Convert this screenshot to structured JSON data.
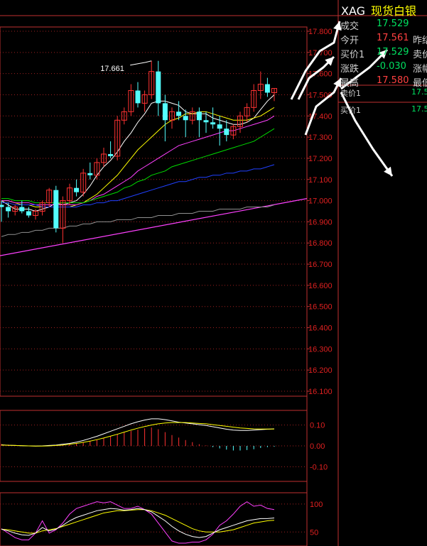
{
  "quote": {
    "code": "XAG",
    "name": "现货白银",
    "rows": [
      {
        "label": "成交",
        "value": "17.529",
        "dir": "dn",
        "label2": ""
      },
      {
        "label": "今开",
        "value": "17.561",
        "dir": "up",
        "label2": "昨结"
      },
      {
        "label": "买价1",
        "value": "17.529",
        "dir": "dn",
        "label2": "卖价"
      },
      {
        "label": "涨跌",
        "value": "-0.030",
        "dir": "dn",
        "label2": "涨幅"
      },
      {
        "label": "最高",
        "value": "17.580",
        "dir": "up",
        "label2": "最低"
      }
    ],
    "sell1_label": "卖价1",
    "sell1_value": "17.5",
    "buy1_label": "买价1",
    "buy1_value": "17.5"
  },
  "chart_data": [
    {
      "type": "candlestick",
      "ylim": [
        16.1,
        17.8
      ],
      "yticks": [
        "17.800",
        "17.700",
        "17.600",
        "17.500",
        "17.400",
        "17.300",
        "17.200",
        "17.100",
        "17.000",
        "16.900",
        "16.800",
        "16.700",
        "16.600",
        "16.500",
        "16.400",
        "16.300",
        "16.200",
        "16.100"
      ],
      "annotation": "17.661",
      "candles": [
        [
          16.98,
          17.0,
          16.9,
          16.97
        ],
        [
          16.97,
          16.99,
          16.92,
          16.95
        ],
        [
          16.95,
          16.98,
          16.93,
          16.97
        ],
        [
          16.97,
          17.0,
          16.94,
          16.95
        ],
        [
          16.95,
          16.97,
          16.92,
          16.93
        ],
        [
          16.93,
          16.96,
          16.91,
          16.95
        ],
        [
          16.95,
          17.0,
          16.93,
          16.99
        ],
        [
          16.99,
          17.06,
          16.97,
          17.05
        ],
        [
          17.05,
          17.07,
          16.85,
          16.87
        ],
        [
          16.87,
          17.02,
          16.8,
          17.0
        ],
        [
          17.0,
          17.08,
          16.98,
          17.06
        ],
        [
          17.06,
          17.1,
          17.02,
          17.04
        ],
        [
          17.04,
          17.15,
          17.02,
          17.13
        ],
        [
          17.13,
          17.18,
          17.1,
          17.12
        ],
        [
          17.12,
          17.2,
          17.1,
          17.18
        ],
        [
          17.18,
          17.25,
          17.16,
          17.22
        ],
        [
          17.22,
          17.28,
          17.2,
          17.21
        ],
        [
          17.21,
          17.4,
          17.19,
          17.38
        ],
        [
          17.38,
          17.44,
          17.36,
          17.42
        ],
        [
          17.42,
          17.55,
          17.4,
          17.52
        ],
        [
          17.52,
          17.56,
          17.44,
          17.46
        ],
        [
          17.46,
          17.52,
          17.42,
          17.5
        ],
        [
          17.5,
          17.66,
          17.48,
          17.61
        ],
        [
          17.61,
          17.66,
          17.4,
          17.46
        ],
        [
          17.46,
          17.5,
          17.28,
          17.38
        ],
        [
          17.38,
          17.44,
          17.34,
          17.42
        ],
        [
          17.42,
          17.47,
          17.38,
          17.4
        ],
        [
          17.4,
          17.43,
          17.3,
          17.38
        ],
        [
          17.38,
          17.44,
          17.36,
          17.42
        ],
        [
          17.42,
          17.44,
          17.3,
          17.38
        ],
        [
          17.38,
          17.42,
          17.32,
          17.37
        ],
        [
          17.37,
          17.44,
          17.34,
          17.36
        ],
        [
          17.36,
          17.4,
          17.26,
          17.34
        ],
        [
          17.34,
          17.38,
          17.28,
          17.31
        ],
        [
          17.31,
          17.36,
          17.29,
          17.35
        ],
        [
          17.35,
          17.42,
          17.32,
          17.4
        ],
        [
          17.4,
          17.46,
          17.37,
          17.44
        ],
        [
          17.44,
          17.55,
          17.42,
          17.52
        ],
        [
          17.52,
          17.61,
          17.48,
          17.55
        ],
        [
          17.55,
          17.58,
          17.49,
          17.51
        ],
        [
          17.51,
          17.53,
          17.47,
          17.53
        ]
      ],
      "moving_averages": [
        {
          "color": "#ffffff",
          "values": [
            17.0,
            16.98,
            16.96,
            16.96,
            16.96,
            16.95,
            16.96,
            16.97,
            16.99,
            16.98,
            16.99,
            17.0,
            17.03,
            17.07,
            17.12,
            17.16,
            17.19,
            17.23,
            17.28,
            17.32,
            17.37,
            17.41,
            17.46,
            17.47,
            17.47,
            17.46,
            17.45,
            17.42,
            17.41,
            17.41,
            17.41,
            17.39,
            17.38,
            17.37,
            17.36,
            17.36,
            17.37,
            17.39,
            17.43,
            17.47,
            17.5
          ]
        },
        {
          "color": "#ffff00",
          "values": [
            17.0,
            17.0,
            16.99,
            16.98,
            16.98,
            16.97,
            16.97,
            16.97,
            16.97,
            16.97,
            16.97,
            16.98,
            16.99,
            17.01,
            17.03,
            17.06,
            17.09,
            17.12,
            17.16,
            17.2,
            17.24,
            17.27,
            17.3,
            17.33,
            17.36,
            17.38,
            17.39,
            17.41,
            17.41,
            17.42,
            17.42,
            17.41,
            17.4,
            17.39,
            17.38,
            17.38,
            17.38,
            17.39,
            17.4,
            17.42,
            17.44
          ]
        },
        {
          "color": "#ff40ff",
          "values": [
            17.0,
            17.0,
            16.99,
            16.99,
            16.99,
            16.98,
            16.98,
            16.98,
            16.98,
            16.98,
            16.98,
            16.98,
            16.99,
            17.0,
            17.02,
            17.03,
            17.05,
            17.07,
            17.09,
            17.11,
            17.14,
            17.16,
            17.18,
            17.2,
            17.22,
            17.24,
            17.26,
            17.27,
            17.28,
            17.29,
            17.3,
            17.31,
            17.32,
            17.33,
            17.33,
            17.34,
            17.35,
            17.36,
            17.37,
            17.38,
            17.4
          ]
        },
        {
          "color": "#00dd00",
          "values": [
            17.01,
            17.01,
            17.0,
            17.0,
            17.0,
            16.99,
            16.99,
            16.99,
            16.99,
            16.99,
            16.99,
            16.99,
            16.99,
            17.0,
            17.01,
            17.02,
            17.03,
            17.04,
            17.06,
            17.07,
            17.09,
            17.1,
            17.12,
            17.13,
            17.14,
            17.16,
            17.17,
            17.18,
            17.19,
            17.2,
            17.21,
            17.22,
            17.23,
            17.24,
            17.25,
            17.26,
            17.27,
            17.28,
            17.3,
            17.32,
            17.34
          ]
        },
        {
          "color": "#2040ff",
          "values": [
            16.99,
            16.99,
            16.98,
            16.98,
            16.98,
            16.98,
            16.97,
            16.97,
            16.97,
            16.97,
            16.97,
            16.97,
            16.98,
            16.98,
            16.99,
            16.99,
            17.0,
            17.0,
            17.01,
            17.02,
            17.03,
            17.04,
            17.05,
            17.06,
            17.07,
            17.08,
            17.09,
            17.09,
            17.1,
            17.11,
            17.11,
            17.12,
            17.12,
            17.13,
            17.13,
            17.14,
            17.14,
            17.15,
            17.15,
            17.16,
            17.17
          ]
        },
        {
          "color": "#909090",
          "values": [
            16.83,
            16.84,
            16.84,
            16.85,
            16.85,
            16.86,
            16.86,
            16.87,
            16.87,
            16.87,
            16.88,
            16.88,
            16.89,
            16.89,
            16.9,
            16.9,
            16.9,
            16.91,
            16.91,
            16.91,
            16.92,
            16.92,
            16.92,
            16.93,
            16.93,
            16.93,
            16.94,
            16.94,
            16.94,
            16.95,
            16.95,
            16.95,
            16.96,
            16.96,
            16.96,
            16.96,
            16.97,
            16.97,
            16.97,
            16.97,
            16.98
          ]
        }
      ],
      "trendline_color": "#ff40ff",
      "trendline_ends": [
        16.74,
        17.01
      ]
    },
    {
      "type": "macd",
      "ylim": [
        -0.15,
        0.15
      ],
      "yticks": [
        "0.10",
        "0.00",
        "-0.10"
      ],
      "bars": [
        0.01,
        0.006,
        0.004,
        0.002,
        0.0,
        -0.002,
        0.0,
        0.004,
        0.004,
        0.006,
        0.01,
        0.014,
        0.018,
        0.024,
        0.03,
        0.038,
        0.046,
        0.056,
        0.064,
        0.072,
        0.078,
        0.084,
        0.088,
        0.08,
        0.066,
        0.052,
        0.04,
        0.028,
        0.018,
        0.008,
        0.002,
        -0.006,
        -0.012,
        -0.018,
        -0.022,
        -0.022,
        -0.02,
        -0.016,
        -0.01,
        -0.006,
        -0.004
      ],
      "dif": [
        0.005,
        0.003,
        0.002,
        0.001,
        0.0,
        -0.001,
        0.0,
        0.002,
        0.004,
        0.008,
        0.012,
        0.018,
        0.026,
        0.036,
        0.046,
        0.058,
        0.07,
        0.082,
        0.094,
        0.106,
        0.116,
        0.124,
        0.13,
        0.13,
        0.126,
        0.12,
        0.114,
        0.11,
        0.106,
        0.102,
        0.098,
        0.092,
        0.086,
        0.08,
        0.076,
        0.074,
        0.074,
        0.076,
        0.078,
        0.08,
        0.082
      ],
      "dea": [
        0.004,
        0.003,
        0.002,
        0.001,
        0.0,
        -0.001,
        -0.001,
        0.0,
        0.002,
        0.004,
        0.008,
        0.012,
        0.017,
        0.023,
        0.03,
        0.038,
        0.047,
        0.056,
        0.066,
        0.076,
        0.085,
        0.093,
        0.1,
        0.106,
        0.11,
        0.112,
        0.112,
        0.112,
        0.11,
        0.108,
        0.106,
        0.102,
        0.098,
        0.094,
        0.09,
        0.086,
        0.084,
        0.082,
        0.081,
        0.081,
        0.081
      ]
    },
    {
      "type": "kdj",
      "ylim": [
        25,
        115
      ],
      "yticks": [
        "100",
        "50"
      ],
      "k": [
        55,
        52,
        48,
        45,
        44,
        48,
        58,
        52,
        55,
        62,
        70,
        76,
        80,
        84,
        88,
        90,
        92,
        91,
        89,
        90,
        92,
        90,
        86,
        78,
        70,
        60,
        52,
        46,
        42,
        40,
        42,
        48,
        54,
        58,
        62,
        66,
        70,
        72,
        74,
        74,
        75
      ],
      "d": [
        55,
        54,
        52,
        50,
        48,
        48,
        52,
        54,
        56,
        60,
        64,
        68,
        72,
        76,
        80,
        84,
        86,
        88,
        88,
        89,
        90,
        90,
        88,
        84,
        80,
        74,
        68,
        62,
        56,
        52,
        50,
        50,
        50,
        52,
        54,
        58,
        62,
        66,
        68,
        70,
        71
      ],
      "j": [
        56,
        48,
        40,
        36,
        36,
        48,
        70,
        48,
        54,
        66,
        82,
        92,
        96,
        100,
        104,
        102,
        104,
        98,
        92,
        92,
        96,
        90,
        82,
        66,
        50,
        34,
        30,
        30,
        32,
        32,
        36,
        46,
        62,
        70,
        82,
        96,
        104,
        96,
        98,
        92,
        90
      ]
    }
  ]
}
